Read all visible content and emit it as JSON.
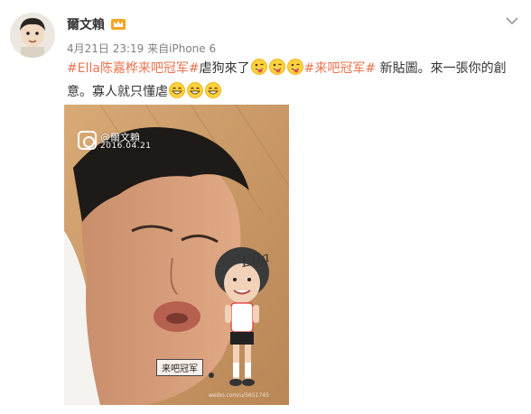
{
  "post": {
    "username": "爾文賴",
    "timestamp": "4月21日 23:19",
    "source_prefix": "来自",
    "source": "iPhone 6",
    "text_segments": [
      {
        "type": "tag",
        "text": "#Ella陈嘉桦来吧冠军#"
      },
      {
        "type": "text",
        "text": "虐狗來了"
      },
      {
        "type": "emoji",
        "name": "tongue-wink-emoji"
      },
      {
        "type": "emoji",
        "name": "tongue-wink-emoji"
      },
      {
        "type": "emoji",
        "name": "tongue-wink-emoji"
      },
      {
        "type": "tag",
        "text": "#来吧冠军#"
      },
      {
        "type": "text",
        "text": " 新貼圖。來一張你的創意。寡人就只懂虐"
      },
      {
        "type": "emoji",
        "name": "grin-emoji"
      },
      {
        "type": "emoji",
        "name": "grin-emoji"
      },
      {
        "type": "emoji",
        "name": "grin-emoji"
      }
    ],
    "icons": {
      "badge": "vip-crown-badge-icon",
      "menu": "chevron-down-icon"
    }
  },
  "photo": {
    "overlay_user": "@爾文賴",
    "overlay_date": "2016.04.21",
    "sticker_script": "Ella",
    "sticker_label": "来吧冠军",
    "watermark": "weibo.com/u/5651745"
  },
  "colors": {
    "tag": "#eb7350",
    "meta": "#808080",
    "text": "#333333"
  }
}
